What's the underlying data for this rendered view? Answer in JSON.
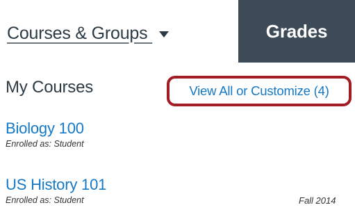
{
  "nav": {
    "courses_groups_label": "Courses & Groups ",
    "grades_label": "Grades"
  },
  "dashboard": {
    "heading": "My Courses",
    "customize_link": "View All or Customize (4)"
  },
  "courses": [
    {
      "name": "Biology 100",
      "enrollment": "Enrolled as: Student",
      "term": ""
    },
    {
      "name": "US History 101",
      "enrollment": "Enrolled as: Student",
      "term": "Fall 2014"
    }
  ],
  "colors": {
    "link": "#1478c6",
    "nav_dark": "#3d4a57",
    "highlight_border": "#a31c24",
    "text": "#2d3b45"
  }
}
